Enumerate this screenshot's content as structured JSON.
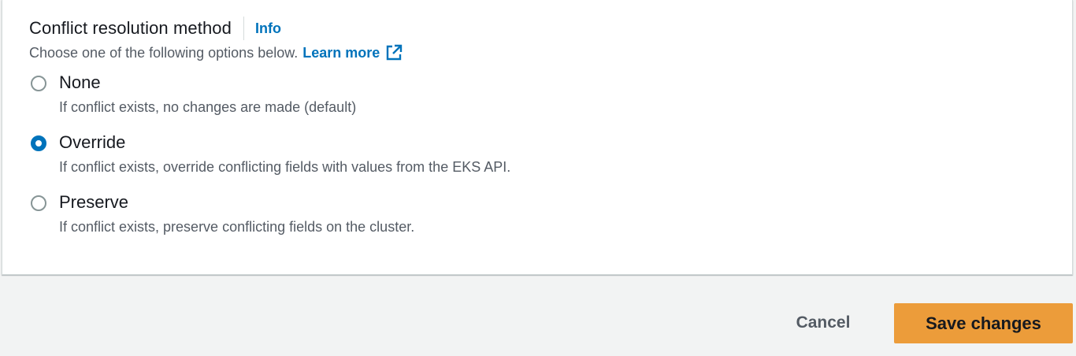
{
  "field": {
    "label": "Conflict resolution method",
    "info_link": "Info",
    "description": "Choose one of the following options below.",
    "learn_more": "Learn more"
  },
  "options": [
    {
      "label": "None",
      "description": "If conflict exists, no changes are made (default)",
      "selected": false
    },
    {
      "label": "Override",
      "description": "If conflict exists, override conflicting fields with values from the EKS API.",
      "selected": true
    },
    {
      "label": "Preserve",
      "description": "If conflict exists, preserve conflicting fields on the cluster.",
      "selected": false
    }
  ],
  "footer": {
    "cancel_label": "Cancel",
    "save_label": "Save changes"
  },
  "colors": {
    "link": "#0073bb",
    "primary_button": "#ec9c3a",
    "background": "#f2f3f3",
    "panel": "#ffffff"
  },
  "icons": {
    "external_link": "external-link-icon"
  }
}
